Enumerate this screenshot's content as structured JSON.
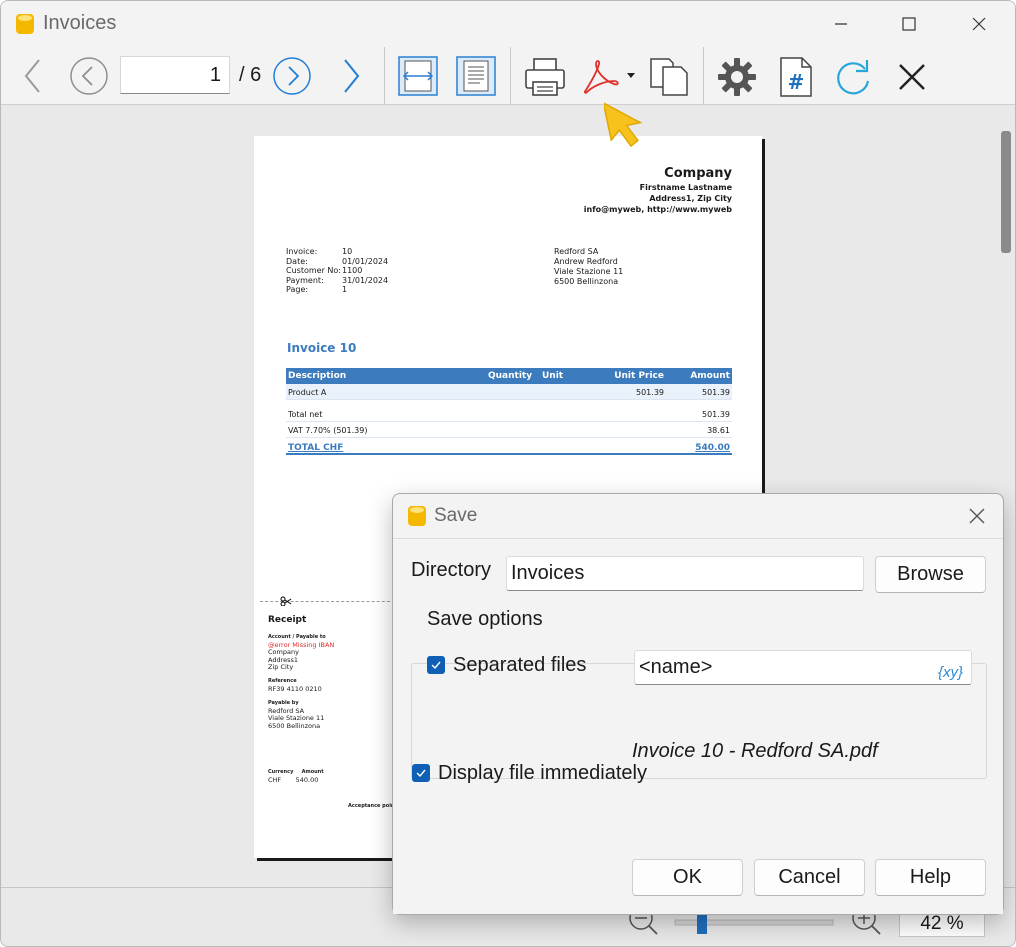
{
  "window": {
    "title": "Invoices"
  },
  "toolbar": {
    "page_current": "1",
    "page_total": "/ 6"
  },
  "document": {
    "company": "Company",
    "address_lines": [
      "Firstname Lastname",
      "Address1, Zip City",
      "info@myweb, http://www.myweb"
    ],
    "meta": [
      {
        "k": "Invoice:",
        "v": "10"
      },
      {
        "k": "Date:",
        "v": "01/01/2024"
      },
      {
        "k": "Customer No:",
        "v": "1100"
      },
      {
        "k": "Payment:",
        "v": "31/01/2024"
      },
      {
        "k": "Page:",
        "v": "1"
      }
    ],
    "customer_lines": [
      "Redford SA",
      "Andrew Redford",
      "Viale Stazione 11",
      "6500 Bellinzona"
    ],
    "invoice_title": "Invoice 10",
    "table": {
      "headers": [
        "Description",
        "Quantity",
        "Unit",
        "Unit Price",
        "Amount"
      ],
      "item": {
        "description": "Product A",
        "unit_price": "501.39",
        "amount": "501.39"
      },
      "total_net": {
        "label": "Total net",
        "amount": "501.39"
      },
      "vat": {
        "label": "VAT 7.70% (501.39)",
        "amount": "38.61"
      },
      "total": {
        "label": "TOTAL CHF",
        "amount": "540.00"
      }
    },
    "receipt": {
      "title": "Receipt",
      "account_label": "Account / Payable to",
      "error": "@error Missing IBAN",
      "account_lines": [
        "Company",
        "Address1",
        "Zip City"
      ],
      "reference_label": "Reference",
      "reference": "RF39 4110 0210",
      "payable_by_label": "Payable by",
      "payable_by_lines": [
        "Redford SA",
        "Viale Stazione 11",
        "6500 Bellinzona"
      ],
      "currency_label": "Currency",
      "amount_label": "Amount",
      "currency": "CHF",
      "amount": "540.00",
      "acceptance": "Acceptance point"
    }
  },
  "zoom": {
    "value": "42 %"
  },
  "dialog": {
    "title": "Save",
    "directory_label": "Directory",
    "directory_value": "Invoices",
    "browse": "Browse",
    "group_label": "Save options",
    "separated_files_label": "Separated files",
    "separated_files_checked": true,
    "name_pattern": "<name>",
    "variables_button": "{xy}",
    "preview_filename": "Invoice 10 - Redford SA.pdf",
    "display_file_label": "Display file immediately",
    "display_file_checked": true,
    "ok": "OK",
    "cancel": "Cancel",
    "help": "Help"
  },
  "colors": {
    "accent": "#1f7fd6",
    "pdf_red": "#e0302a",
    "invoice_blue": "#3b7bbf",
    "cursor_yellow": "#f7c21b"
  }
}
